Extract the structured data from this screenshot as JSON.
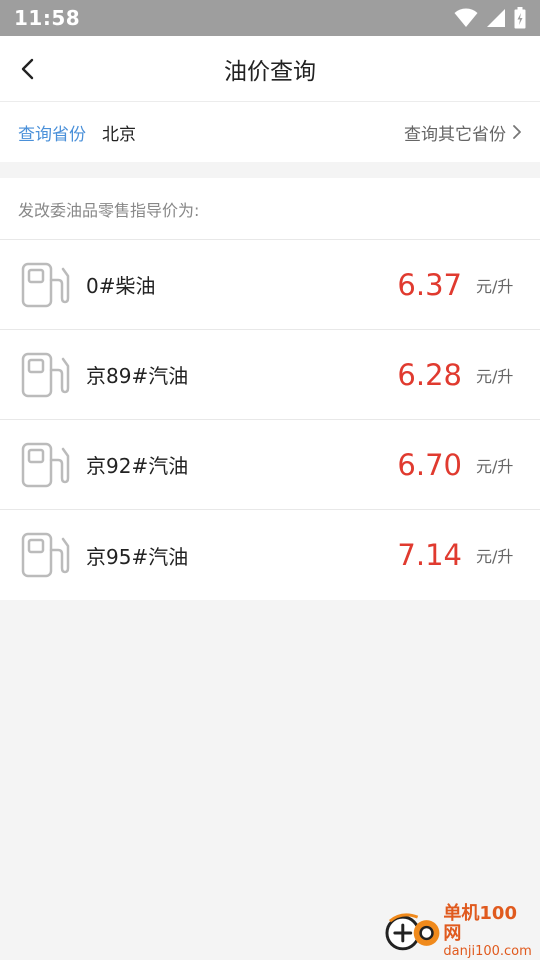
{
  "status_bar": {
    "time": "11:58"
  },
  "header": {
    "title": "油价查询"
  },
  "province": {
    "label": "查询省份",
    "value": "北京",
    "link": "查询其它省份"
  },
  "guide": {
    "text": "发改委油品零售指导价为:"
  },
  "prices": [
    {
      "name": "0#柴油",
      "price": "6.37",
      "unit": "元/升"
    },
    {
      "name": "京89#汽油",
      "price": "6.28",
      "unit": "元/升"
    },
    {
      "name": "京92#汽油",
      "price": "6.70",
      "unit": "元/升"
    },
    {
      "name": "京95#汽油",
      "price": "7.14",
      "unit": "元/升"
    }
  ],
  "watermark": {
    "title": "单机100网",
    "subtitle": "danji100.com"
  },
  "colors": {
    "accent": "#4a90d9",
    "price": "#e03a2f",
    "status_bar": "#9e9e9e"
  }
}
